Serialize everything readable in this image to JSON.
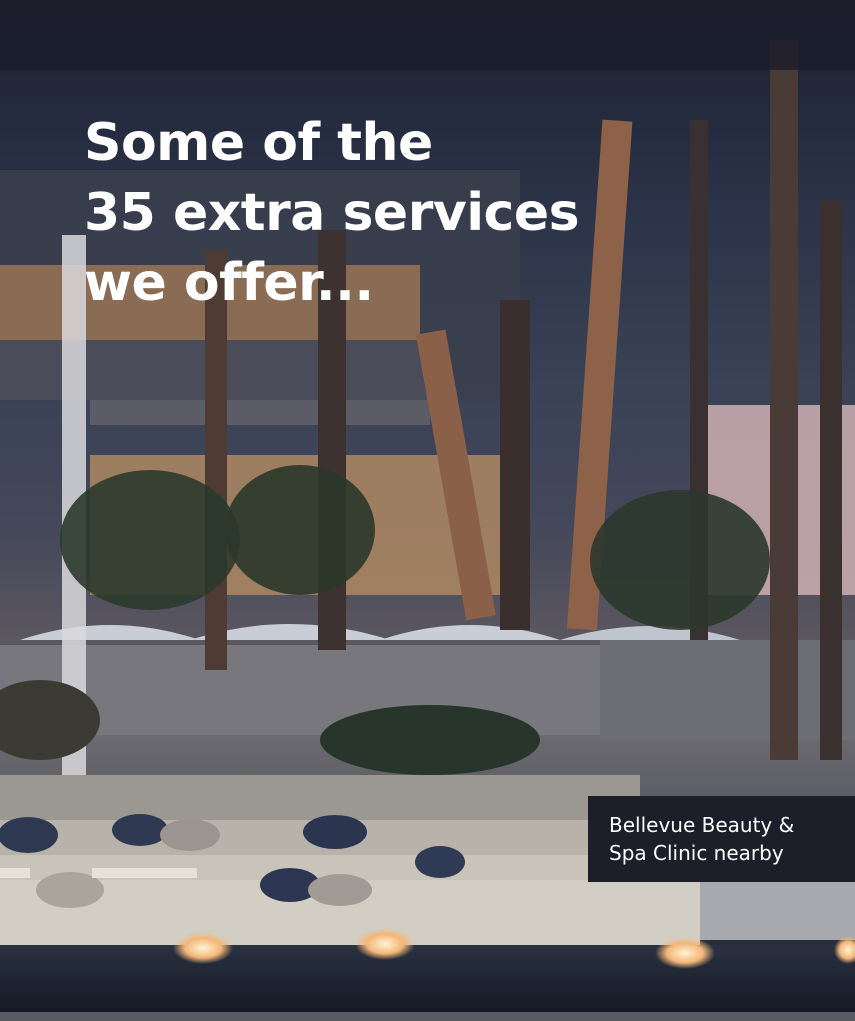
{
  "hero": {
    "headline_lines": [
      "Some of the",
      "35 extra services",
      "we offer..."
    ],
    "caption_lines": [
      "Bellevue Beauty &",
      "Spa Clinic nearby"
    ]
  }
}
